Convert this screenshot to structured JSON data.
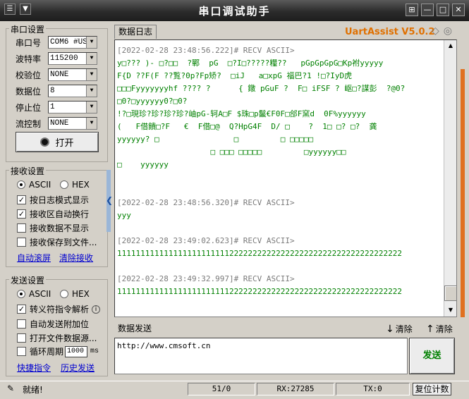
{
  "title_bar": {
    "title": "串口调试助手",
    "menu_glyph": "☰",
    "menu_arrow": "▼",
    "pin_glyph": "⊞",
    "min_glyph": "—",
    "max_glyph": "□",
    "close_glyph": "✕"
  },
  "serial_settings": {
    "group_title": "串口设置",
    "fields": [
      {
        "label": "串口号",
        "value": "COM6 #US"
      },
      {
        "label": "波特率",
        "value": "115200"
      },
      {
        "label": "校验位",
        "value": "NONE"
      },
      {
        "label": "数据位",
        "value": "8"
      },
      {
        "label": "停止位",
        "value": "1"
      },
      {
        "label": "流控制",
        "value": "NONE"
      }
    ],
    "open_button": "打开"
  },
  "receive_settings": {
    "group_title": "接收设置",
    "radio_ascii": "ASCII",
    "radio_hex": "HEX",
    "options": [
      {
        "label": "按日志模式显示",
        "checked": true
      },
      {
        "label": "接收区自动换行",
        "checked": true
      },
      {
        "label": "接收数据不显示",
        "checked": false
      },
      {
        "label": "接收保存到文件...",
        "checked": false
      }
    ],
    "auto_scroll": "自动滚屏",
    "clear_recv": "清除接收"
  },
  "send_settings": {
    "group_title": "发送设置",
    "radio_ascii": "ASCII",
    "radio_hex": "HEX",
    "options": [
      {
        "label": "转义符指令解析",
        "checked": true
      },
      {
        "label": "自动发送附加位",
        "checked": false
      },
      {
        "label": "打开文件数据源...",
        "checked": false
      },
      {
        "label": "循环周期",
        "checked": false
      }
    ],
    "period_value": "1000",
    "period_unit": "ms",
    "quick_cmd": "快捷指令",
    "history_send": "历史发送"
  },
  "log": {
    "tab_label": "数据日志",
    "brand": "UartAssist V5.0.2",
    "entries": [
      {
        "header": "[2022-02-28 23:48:56.222]# RECV ASCII>",
        "lines": [
          "y□??? )- □?□□  ?鄲  pG  □?I□?????糧??   pGpGpGpG□Kp祔yyyyy",
          "F{D ??F(F ??覧?0p?Fp矫?  □iJ   a□xpG 福巴?1 !□?IyD虎",
          "□□□Fyyyyyyyhf ???? ?      { 鐓 pGuF ?  F□ iFSF ? 岖□?謀彭  ?@0?",
          "□0?□yyyyyy0?□0?",
          "!?□現珍?珍?珍?珍?岫pG-轲A□F $珠□p鬣€F0F□郃F窯d  0F%yyyyyy",
          "(   F借饋□?F   €  F借□@  Q?HpG4F  D/ □    ?  1□ □? □?  龚",
          "yyyyyy? □                □         □ □□□□□",
          "                    □ □□□ □□□□□         □yyyyyy□□",
          "□    yyyyyy"
        ]
      },
      {
        "header": "[2022-02-28 23:48:56.320]# RECV ASCII>",
        "lines": [
          "yyy"
        ]
      },
      {
        "header": "[2022-02-28 23:49:02.623]# RECV ASCII>",
        "lines": [
          "1111111111111111111111112222222222222222222222222222222222222"
        ]
      },
      {
        "header": "[2022-02-28 23:49:32.997]# RECV ASCII>",
        "lines": [
          "1111111111111111111111112222222222222222222222222222222222222"
        ]
      }
    ]
  },
  "send_area": {
    "tab_label": "数据发送",
    "clear1": "清除",
    "clear2": "清除",
    "text": "http://www.cmsoft.cn",
    "send_button": "发送"
  },
  "status_bar": {
    "status_text": "就绪!",
    "counter": "51/0",
    "rx": "RX:27285",
    "tx": "TX:0",
    "reset_button": "复位计数"
  }
}
